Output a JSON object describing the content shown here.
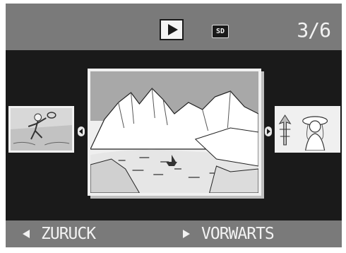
{
  "status_bar": {
    "mode_icon": "playback-icon",
    "storage_label": "SD",
    "image_counter": "3/6"
  },
  "images": {
    "previous": "thumbnail-tennis-player",
    "current": "thumbnail-mountain-lake-boat",
    "next": "thumbnail-woman-in-hat-pagoda"
  },
  "navigation": {
    "back_label": "ZURUCK",
    "forward_label": "VORWARTS"
  },
  "colors": {
    "bar_gray": "#7a7a7a",
    "screen_black": "#1a1a1a",
    "text_white": "#f2f2f2"
  }
}
